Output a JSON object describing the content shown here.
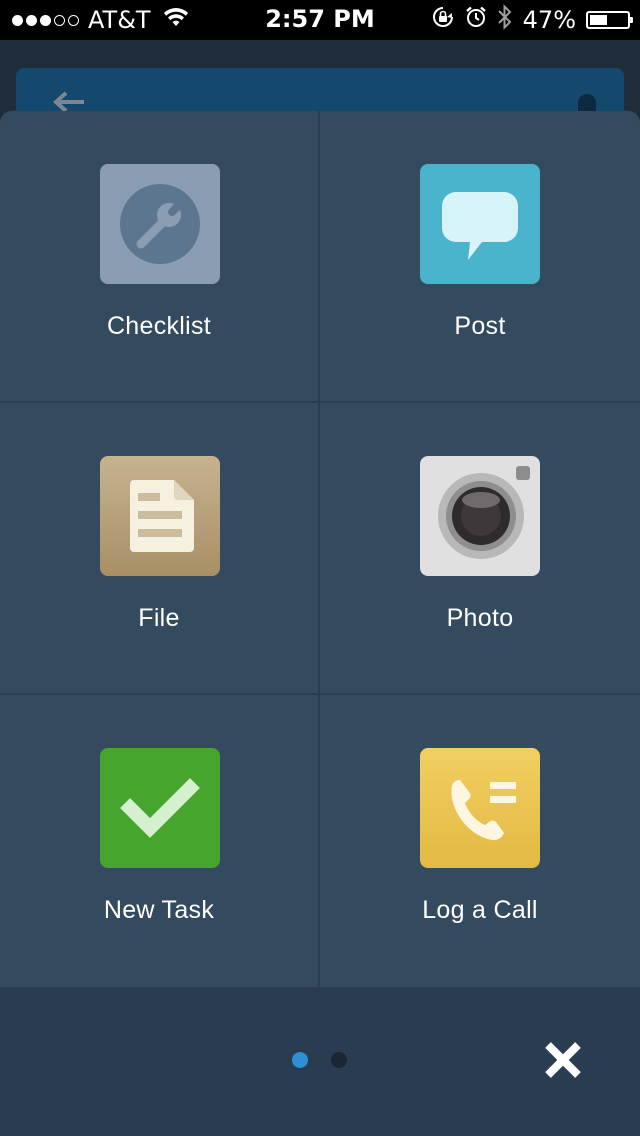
{
  "status_bar": {
    "carrier": "AT&T",
    "time": "2:57 PM",
    "battery_percent": "47%",
    "battery_level": 0.47,
    "signal_bars_filled": 3,
    "signal_bars_total": 5
  },
  "actions": [
    {
      "label": "Checklist",
      "icon": "wrench-icon",
      "color": "#8a9db3"
    },
    {
      "label": "Post",
      "icon": "speech-bubble-icon",
      "color": "#4ab4cc"
    },
    {
      "label": "File",
      "icon": "document-icon",
      "color": "#b5a07c"
    },
    {
      "label": "Photo",
      "icon": "camera-icon",
      "color": "#e0e0e0"
    },
    {
      "label": "New Task",
      "icon": "checkmark-icon",
      "color": "#45a52d"
    },
    {
      "label": "Log a Call",
      "icon": "phone-log-icon",
      "color": "#ebc451"
    }
  ],
  "pagination": {
    "current_page": 1,
    "total_pages": 2,
    "active_color": "#2d8fd5",
    "inactive_color": "#1a2633"
  },
  "close": {
    "icon": "close-icon"
  }
}
